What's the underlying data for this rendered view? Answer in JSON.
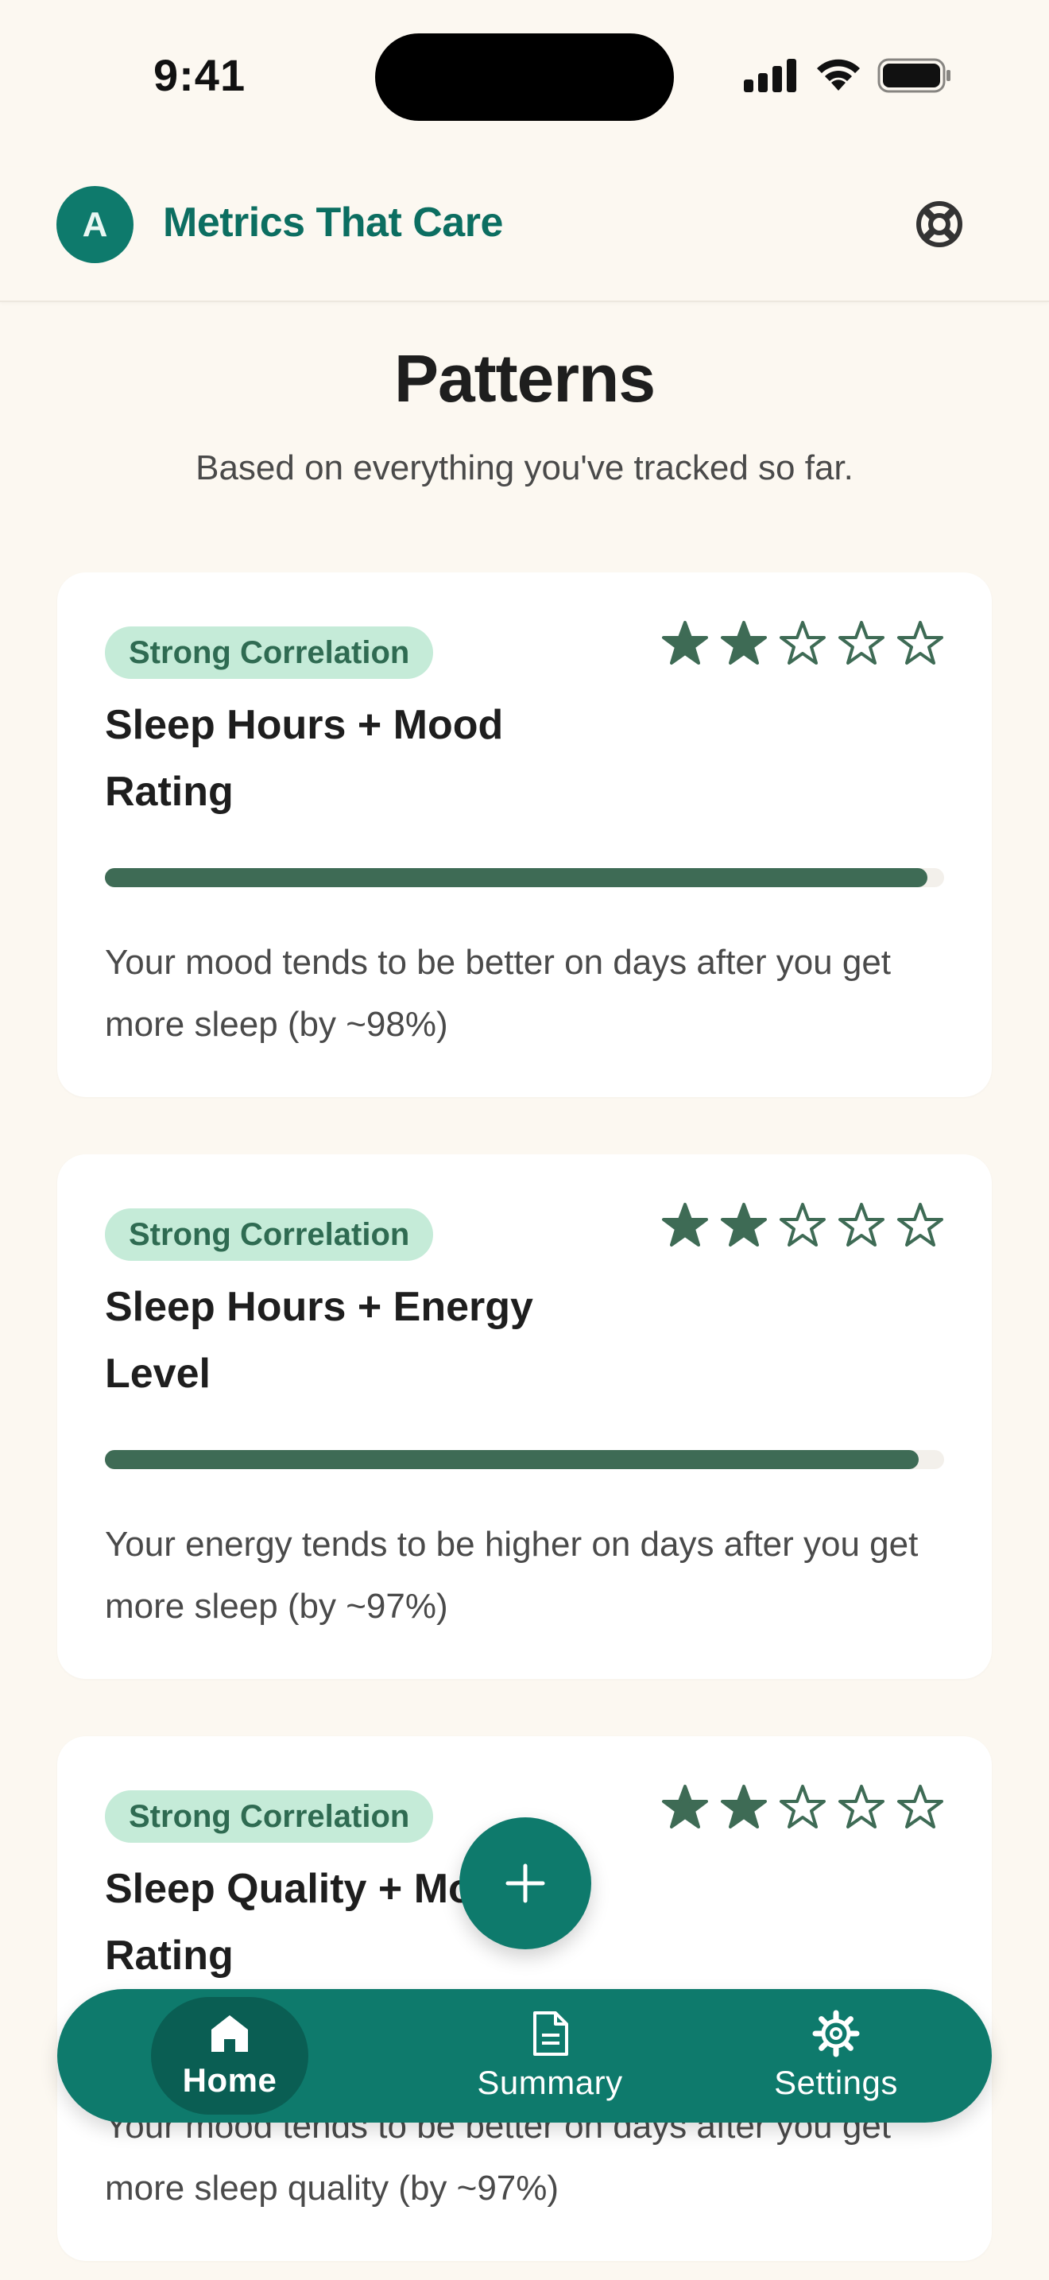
{
  "status_bar": {
    "time": "9:41"
  },
  "header": {
    "avatar_initial": "A",
    "title": "Metrics That Care"
  },
  "page": {
    "title": "Patterns",
    "subtitle": "Based on everything you've tracked so far."
  },
  "patterns": [
    {
      "badge": "Strong Correlation",
      "title": "Sleep Hours + Mood Rating",
      "rating": 2,
      "max_rating": 5,
      "strength": 0.98,
      "description": "Your mood tends to be better on days after you get more sleep (by ~98%)"
    },
    {
      "badge": "Strong Correlation",
      "title": "Sleep Hours + Energy Level",
      "rating": 2,
      "max_rating": 5,
      "strength": 0.97,
      "description": "Your energy tends to be higher on days after you get more sleep (by ~97%)"
    },
    {
      "badge": "Strong Correlation",
      "title": "Sleep Quality + Mood Rating",
      "rating": 2,
      "max_rating": 5,
      "strength": 0.97,
      "description": "Your mood tends to be better on days after you get more sleep quality (by ~97%)"
    }
  ],
  "nav": {
    "home": "Home",
    "summary": "Summary",
    "settings": "Settings",
    "active": "home"
  },
  "colors": {
    "background": "#FCF8F1",
    "brand": "#0E7A6C",
    "badge_bg": "#C5EBD8",
    "badge_text": "#2F6B52",
    "bar": "#3E6B55",
    "star": "#3E6B55"
  },
  "icons": {
    "fab": "plus-icon",
    "header_action": "lifebuoy-icon",
    "home": "home-icon",
    "summary": "document-icon",
    "settings": "gear-icon"
  }
}
